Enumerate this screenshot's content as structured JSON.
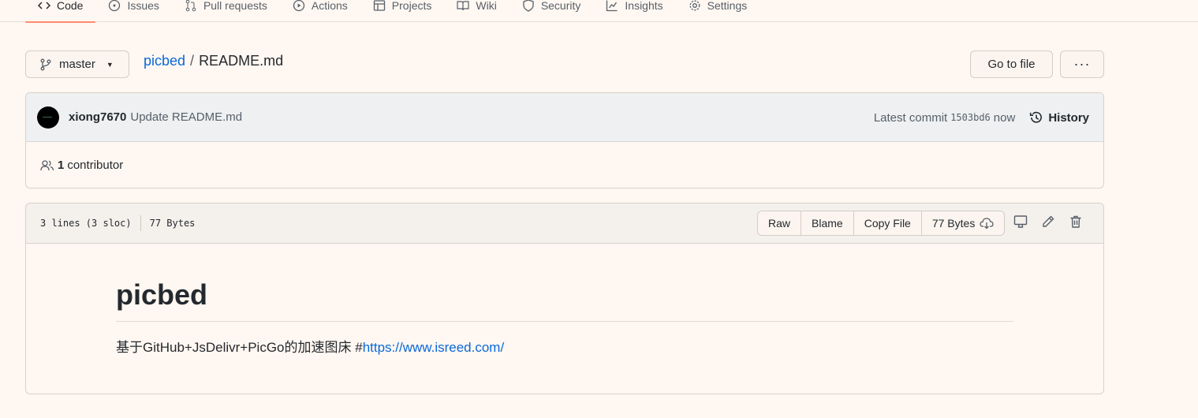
{
  "tabs": [
    {
      "label": "Code",
      "icon": "code-icon",
      "active": true
    },
    {
      "label": "Issues",
      "icon": "issue-icon"
    },
    {
      "label": "Pull requests",
      "icon": "pull-request-icon"
    },
    {
      "label": "Actions",
      "icon": "play-icon"
    },
    {
      "label": "Projects",
      "icon": "table-icon"
    },
    {
      "label": "Wiki",
      "icon": "book-icon"
    },
    {
      "label": "Security",
      "icon": "shield-icon"
    },
    {
      "label": "Insights",
      "icon": "graph-icon"
    },
    {
      "label": "Settings",
      "icon": "gear-icon"
    }
  ],
  "branch": {
    "name": "master"
  },
  "breadcrumb": {
    "repo": "picbed",
    "separator": "/",
    "file": "README.md"
  },
  "actions": {
    "goto_file": "Go to file",
    "more": "···"
  },
  "commit": {
    "author": "xiong7670",
    "message": "Update README.md",
    "latest_label": "Latest commit",
    "sha": "1503bd6",
    "time": "now",
    "history_label": "History"
  },
  "contributors": {
    "count": "1",
    "label": "contributor"
  },
  "file": {
    "lines": "3 lines (3 sloc)",
    "size": "77 Bytes",
    "buttons": {
      "raw": "Raw",
      "blame": "Blame",
      "copy": "Copy File",
      "size": "77 Bytes"
    }
  },
  "readme": {
    "heading": "picbed",
    "text": "基于GitHub+JsDelivr+PicGo的加速图床 #",
    "link": "https://www.isreed.com/"
  },
  "colors": {
    "link": "#0969da",
    "active_tab": "#fd8c73",
    "background": "#fff7f1"
  }
}
